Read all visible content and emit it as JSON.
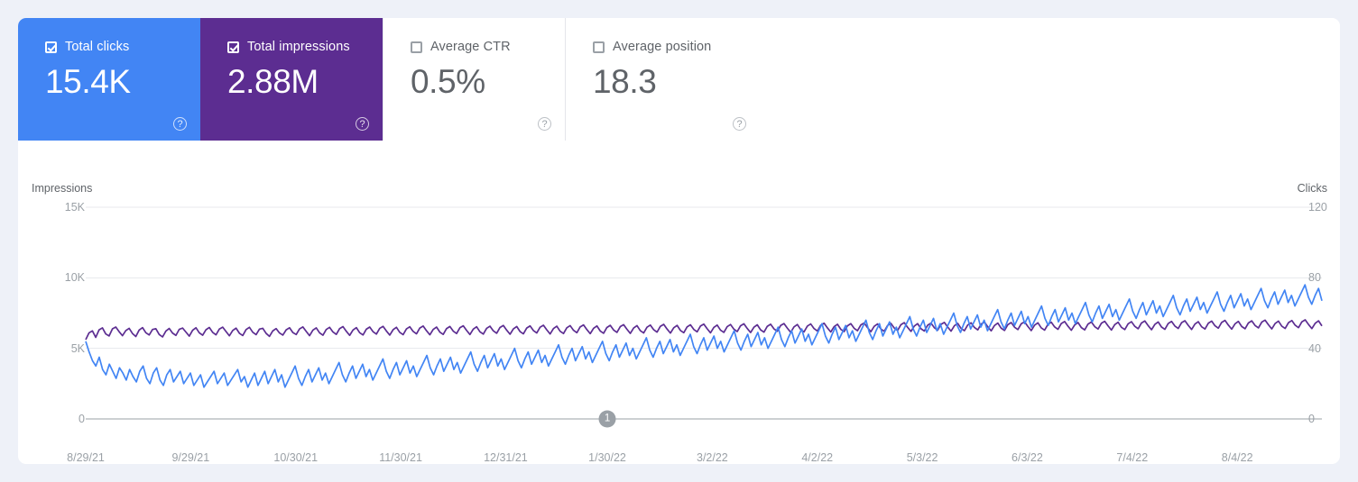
{
  "metrics": [
    {
      "name": "total-clicks",
      "label": "Total clicks",
      "value": "15.4K",
      "checked": true,
      "style": "clicks"
    },
    {
      "name": "total-impressions",
      "label": "Total impressions",
      "value": "2.88M",
      "checked": true,
      "style": "impressions"
    },
    {
      "name": "average-ctr",
      "label": "Average CTR",
      "value": "0.5%",
      "checked": false,
      "style": "plain"
    },
    {
      "name": "average-position",
      "label": "Average position",
      "value": "18.3",
      "checked": false,
      "style": "plain"
    }
  ],
  "help_glyph": "?",
  "annotation": {
    "label": "1",
    "x_date": "1/30/22"
  },
  "chart_data": {
    "type": "line",
    "title": "",
    "xlabel": "",
    "grid": true,
    "legend": "none",
    "left_axis": {
      "label": "Impressions",
      "ticks": [
        0,
        5000,
        10000,
        15000
      ],
      "tick_labels": [
        "0",
        "5K",
        "10K",
        "15K"
      ],
      "ylim": [
        0,
        15000
      ]
    },
    "right_axis": {
      "label": "Clicks",
      "ticks": [
        0,
        40,
        80,
        120
      ],
      "tick_labels": [
        "0",
        "40",
        "80",
        "120"
      ],
      "ylim": [
        0,
        120
      ]
    },
    "x_tick_labels": [
      "8/29/21",
      "9/29/21",
      "10/30/21",
      "11/30/21",
      "12/31/21",
      "1/30/22",
      "3/2/22",
      "4/2/22",
      "5/3/22",
      "6/3/22",
      "7/4/22",
      "8/4/22"
    ],
    "x_tick_positions": [
      0,
      31,
      62,
      93,
      124,
      154,
      185,
      216,
      247,
      278,
      309,
      340
    ],
    "n_points": 366,
    "series": [
      {
        "name": "Impressions",
        "axis": "left",
        "color": "#5c2d91",
        "values": [
          5620,
          6100,
          6240,
          5780,
          6310,
          6450,
          6020,
          5880,
          6380,
          6510,
          6180,
          5900,
          6260,
          6420,
          6050,
          5840,
          6300,
          6470,
          6110,
          5950,
          6340,
          6390,
          5980,
          5810,
          6230,
          6410,
          6080,
          5920,
          6350,
          6440,
          6150,
          5870,
          6280,
          6460,
          6100,
          5930,
          6320,
          6480,
          6130,
          5960,
          6370,
          6500,
          6190,
          5890,
          6270,
          6430,
          6070,
          5910,
          6330,
          6490,
          6140,
          5970,
          6360,
          6420,
          6060,
          5850,
          6240,
          6400,
          6090,
          5940,
          6310,
          6460,
          6120,
          5980,
          6380,
          6520,
          6200,
          5900,
          6290,
          6450,
          6100,
          5930,
          6340,
          6490,
          6160,
          5990,
          6400,
          6540,
          6210,
          5920,
          6300,
          6470,
          6110,
          5950,
          6360,
          6510,
          6180,
          6010,
          6420,
          6560,
          6230,
          5940,
          6320,
          6490,
          6130,
          5970,
          6380,
          6530,
          6200,
          6030,
          6440,
          6580,
          6250,
          5960,
          6340,
          6510,
          6150,
          5990,
          6400,
          6550,
          6220,
          6050,
          6460,
          6600,
          6270,
          5980,
          6360,
          6530,
          6170,
          6010,
          6420,
          6570,
          6240,
          6070,
          6480,
          6620,
          6290,
          6000,
          6380,
          6550,
          6190,
          6030,
          6440,
          6590,
          6260,
          6090,
          6500,
          6640,
          6310,
          6020,
          6400,
          6570,
          6210,
          6050,
          6460,
          6610,
          6280,
          6110,
          6520,
          6660,
          6330,
          6040,
          6420,
          6590,
          6230,
          6070,
          6480,
          6630,
          6300,
          6130,
          6540,
          6680,
          6350,
          6060,
          6440,
          6610,
          6250,
          6090,
          6500,
          6650,
          6320,
          6150,
          6560,
          6700,
          6370,
          6080,
          6460,
          6630,
          6270,
          6110,
          6520,
          6670,
          6340,
          6170,
          6580,
          6720,
          6390,
          6100,
          6480,
          6650,
          6290,
          6130,
          6540,
          6690,
          6360,
          6190,
          6600,
          6740,
          6410,
          6120,
          6500,
          6670,
          6310,
          6150,
          6560,
          6710,
          6380,
          6210,
          6620,
          6760,
          6430,
          6140,
          6520,
          6690,
          6330,
          6170,
          6580,
          6730,
          6400,
          6230,
          6640,
          6780,
          6450,
          6160,
          6540,
          6710,
          6350,
          6190,
          6600,
          6750,
          6420,
          6250,
          6660,
          6800,
          6470,
          6180,
          6560,
          6730,
          6370,
          6210,
          6620,
          6770,
          6440,
          6270,
          6680,
          6820,
          6490,
          6200,
          6580,
          6750,
          6390,
          6230,
          6640,
          6790,
          6460,
          6290,
          6700,
          6840,
          6510,
          6220,
          6600,
          6770,
          6410,
          6250,
          6660,
          6810,
          6480,
          6310,
          6720,
          6860,
          6530,
          6240,
          6620,
          6790,
          6430,
          6270,
          6680,
          6830,
          6500,
          6330,
          6740,
          6880,
          6550,
          6260,
          6640,
          6810,
          6450,
          6290,
          6700,
          6850,
          6520,
          6350,
          6760,
          6900,
          6570,
          6280,
          6660,
          6830,
          6470,
          6310,
          6720,
          6870,
          6540,
          6370,
          6780,
          6920,
          6590,
          6300,
          6680,
          6850,
          6490,
          6330,
          6740,
          6890,
          6560,
          6390,
          6800,
          6940,
          6610,
          6320,
          6700,
          6870,
          6510,
          6350,
          6760,
          6910,
          6580,
          6410,
          6820,
          6960,
          6630,
          6340,
          6720,
          6890,
          6530,
          6370,
          6780,
          6930,
          6600,
          6430,
          6840,
          6980,
          6650,
          6360,
          6740,
          6910,
          6550,
          6390,
          6800,
          6950,
          6620,
          6450,
          6860,
          7000,
          6670,
          6380,
          6760,
          6930,
          6570,
          6410,
          6820,
          6970,
          6640,
          6470,
          6880,
          7020,
          6690,
          6400,
          6780,
          6950,
          6590
        ]
      },
      {
        "name": "Clicks",
        "axis": "right",
        "color": "#4285f4",
        "values": [
          44,
          38,
          33,
          30,
          35,
          28,
          25,
          31,
          27,
          23,
          29,
          26,
          22,
          28,
          24,
          21,
          27,
          30,
          23,
          20,
          26,
          29,
          22,
          19,
          25,
          28,
          21,
          24,
          27,
          20,
          23,
          26,
          19,
          22,
          25,
          18,
          21,
          24,
          27,
          20,
          23,
          26,
          19,
          22,
          25,
          28,
          21,
          24,
          18,
          22,
          26,
          19,
          23,
          27,
          20,
          24,
          28,
          21,
          25,
          18,
          22,
          26,
          30,
          23,
          19,
          24,
          28,
          21,
          25,
          29,
          22,
          26,
          20,
          24,
          28,
          32,
          25,
          21,
          26,
          30,
          23,
          27,
          31,
          24,
          28,
          22,
          26,
          30,
          34,
          27,
          23,
          28,
          32,
          25,
          29,
          33,
          26,
          30,
          24,
          28,
          32,
          36,
          29,
          25,
          30,
          34,
          27,
          31,
          35,
          28,
          32,
          26,
          30,
          34,
          38,
          31,
          27,
          32,
          36,
          29,
          33,
          37,
          30,
          34,
          28,
          32,
          36,
          40,
          33,
          29,
          34,
          38,
          31,
          35,
          39,
          32,
          36,
          30,
          34,
          38,
          42,
          35,
          31,
          36,
          40,
          33,
          37,
          41,
          34,
          38,
          32,
          36,
          40,
          44,
          37,
          33,
          38,
          42,
          35,
          39,
          43,
          36,
          40,
          34,
          38,
          42,
          46,
          39,
          35,
          40,
          44,
          37,
          41,
          45,
          38,
          42,
          36,
          40,
          44,
          48,
          41,
          37,
          42,
          46,
          39,
          43,
          47,
          40,
          44,
          38,
          42,
          46,
          50,
          43,
          39,
          44,
          48,
          41,
          45,
          49,
          42,
          46,
          40,
          44,
          48,
          52,
          45,
          41,
          46,
          50,
          43,
          47,
          51,
          44,
          48,
          42,
          46,
          50,
          54,
          47,
          43,
          48,
          52,
          45,
          49,
          53,
          46,
          50,
          44,
          48,
          52,
          56,
          49,
          45,
          50,
          54,
          47,
          51,
          55,
          48,
          52,
          46,
          50,
          54,
          58,
          51,
          47,
          52,
          56,
          49,
          53,
          57,
          50,
          54,
          48,
          52,
          56,
          60,
          53,
          49,
          54,
          58,
          51,
          55,
          59,
          52,
          56,
          50,
          54,
          58,
          62,
          55,
          51,
          56,
          60,
          53,
          57,
          61,
          54,
          58,
          52,
          56,
          60,
          64,
          57,
          53,
          58,
          62,
          55,
          59,
          63,
          56,
          60,
          54,
          58,
          62,
          66,
          59,
          55,
          60,
          64,
          57,
          61,
          65,
          58,
          62,
          56,
          60,
          64,
          68,
          61,
          57,
          62,
          66,
          59,
          63,
          67,
          60,
          64,
          58,
          62,
          66,
          70,
          63,
          59,
          64,
          68,
          61,
          65,
          69,
          62,
          66,
          60,
          64,
          68,
          72,
          65,
          61,
          66,
          70,
          63,
          67,
          71,
          64,
          68,
          62,
          66,
          70,
          74,
          67,
          63,
          68,
          72,
          65,
          69,
          73,
          66,
          70,
          64,
          68,
          72,
          76,
          69,
          65,
          70,
          74,
          67
        ]
      }
    ]
  }
}
